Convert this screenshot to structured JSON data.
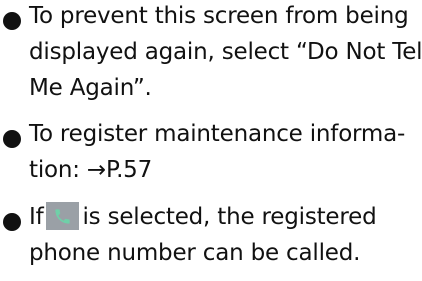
{
  "bullets": [
    {
      "lines": [
        "To prevent this screen from being",
        "displayed again, select “Do Not Tell",
        "Me Again”."
      ]
    },
    {
      "lines": [
        "To register maintenance informa-",
        "tion: →P.57"
      ]
    },
    {
      "prefix": "If",
      "icon": "phone-icon",
      "suffix": "is selected, the registered",
      "line2": "phone number can be called."
    }
  ],
  "colors": {
    "text": "#111111",
    "icon_bg": "#9aa0a6",
    "icon_fg": "#6fd0a8"
  }
}
